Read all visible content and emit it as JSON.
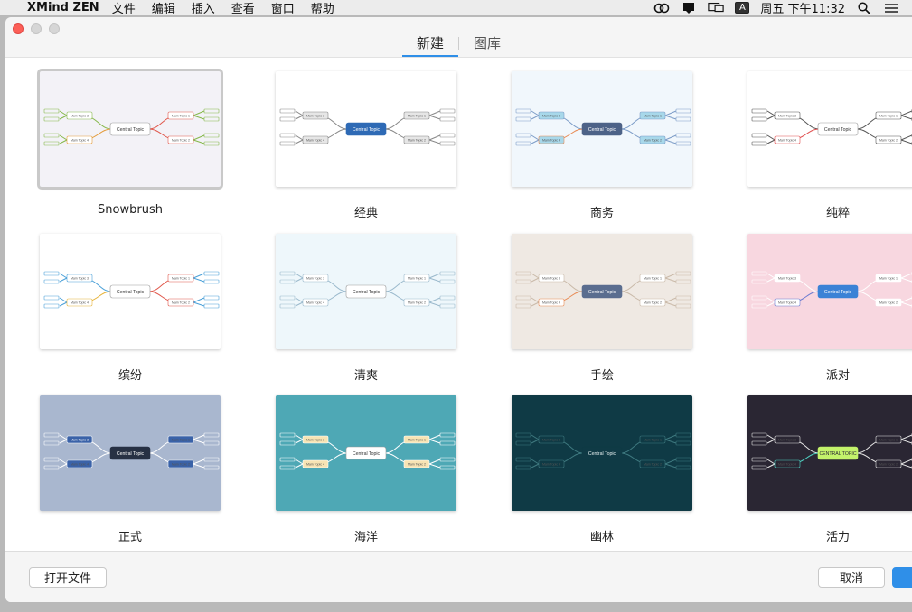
{
  "menubar": {
    "app_name": "XMind ZEN",
    "menus": [
      "文件",
      "编辑",
      "插入",
      "查看",
      "窗口",
      "帮助"
    ],
    "clock": "周五 下午11:32",
    "input_badge": "A"
  },
  "tabs": [
    {
      "label": "新建",
      "active": true
    },
    {
      "label": "图库",
      "active": false
    }
  ],
  "templates": [
    {
      "name": "Snowbrush",
      "bg": "#f3f2f7",
      "center": "#ffffff",
      "centerText": "#333333",
      "topic": "#ffffff",
      "line1": "#86b84a",
      "line2": "#e0584c",
      "line3": "#e39b3a",
      "central_label": "Central Topic",
      "main_labels": [
        "Main Topic 3",
        "Main Topic 1",
        "Main Topic 4",
        "Main Topic 2"
      ]
    },
    {
      "name": "经典",
      "bg": "#ffffff",
      "center": "#2e6ab5",
      "centerText": "#ffffff",
      "topic": "#e6e6e6",
      "line1": "#888888",
      "line2": "#888888",
      "line3": "#888888",
      "central_label": "Central Topic",
      "main_labels": [
        "Main Topic 3",
        "Main Topic 1",
        "Main Topic 4",
        "Main Topic 2"
      ]
    },
    {
      "name": "商务",
      "bg": "#f1f7fc",
      "center": "#4d6287",
      "centerText": "#ffffff",
      "topic": "#a8d8ea",
      "line1": "#7c9cc7",
      "line2": "#7c9cc7",
      "line3": "#e88b55",
      "central_label": "Central Topic",
      "main_labels": [
        "Main Topic 3",
        "Main Topic 1",
        "Main Topic 4",
        "Main Topic 2"
      ]
    },
    {
      "name": "纯粹",
      "bg": "#ffffff",
      "center": "#ffffff",
      "centerText": "#333333",
      "topic": "#ffffff",
      "line1": "#555555",
      "line2": "#555555",
      "line3": "#e05050",
      "central_label": "Central Topic",
      "main_labels": [
        "Main Topic 3",
        "Main Topic 1",
        "Main Topic 4",
        "Main Topic 2"
      ]
    },
    {
      "name": "缤纷",
      "bg": "#ffffff",
      "center": "#ffffff",
      "centerText": "#333333",
      "topic": "#ffffff",
      "line1": "#4aa0d8",
      "line2": "#e0584c",
      "line3": "#e6b33a",
      "central_label": "Central Topic",
      "main_labels": [
        "Main Topic 3",
        "Main Topic 1",
        "Main Topic 4",
        "Main Topic 2"
      ]
    },
    {
      "name": "清爽",
      "bg": "#eef7fb",
      "center": "#ffffff",
      "centerText": "#333333",
      "topic": "#ffffff",
      "line1": "#9ab9cc",
      "line2": "#9ab9cc",
      "line3": "#9ab9cc",
      "central_label": "Central Topic",
      "main_labels": [
        "Main Topic 3",
        "Main Topic 1",
        "Main Topic 4",
        "Main Topic 2"
      ]
    },
    {
      "name": "手绘",
      "bg": "#efe9e3",
      "center": "#5a6d8f",
      "centerText": "#ffffff",
      "topic": "#ffffff",
      "line1": "#c9b9a8",
      "line2": "#c9b9a8",
      "line3": "#e88b55",
      "central_label": "Central Topic",
      "main_labels": [
        "Main Topic 3",
        "Main Topic 1",
        "Main Topic 4",
        "Main Topic 2"
      ]
    },
    {
      "name": "派对",
      "bg": "#f8d7e0",
      "center": "#3b82d6",
      "centerText": "#ffffff",
      "topic": "#ffffff",
      "line1": "#ffffff",
      "line2": "#ffffff",
      "line3": "#6b7bd0",
      "central_label": "Central Topic",
      "main_labels": [
        "Main Topic 3",
        "Main Topic 1",
        "Main Topic 4",
        "Main Topic 2"
      ]
    },
    {
      "name": "正式",
      "bg": "#a9b7cf",
      "center": "#273144",
      "centerText": "#ffffff",
      "topic": "#3a62a8",
      "line1": "#ffffff",
      "line2": "#ffffff",
      "line3": "#ffffff",
      "central_label": "Central Topic",
      "main_labels": [
        "Main Topic 3",
        "Main Topic 1",
        "Main Topic 4",
        "Main Topic 2"
      ]
    },
    {
      "name": "海洋",
      "bg": "#4ea8b5",
      "center": "#ffffff",
      "centerText": "#333333",
      "topic": "#f7e4b4",
      "line1": "#ffffff",
      "line2": "#ffffff",
      "line3": "#ffffff",
      "central_label": "Central Topic",
      "main_labels": [
        "Main Topic 3",
        "Main Topic 1",
        "Main Topic 4",
        "Main Topic 2"
      ]
    },
    {
      "name": "幽林",
      "bg": "#0f3a45",
      "center": "#0f3a45",
      "centerText": "#e6f0f0",
      "topic": "#0f3a45",
      "line1": "#3f7a80",
      "line2": "#3f7a80",
      "line3": "#3f7a80",
      "central_label": "Central Topic",
      "main_labels": [
        "Main Topic 3",
        "Main Topic 1",
        "Main Topic 4",
        "Main Topic 2"
      ]
    },
    {
      "name": "活力",
      "bg": "#2a2633",
      "center": "#c3f26b",
      "centerText": "#2a2633",
      "topic": "#2a2633",
      "line1": "#e6e6e6",
      "line2": "#e6e6e6",
      "line3": "#4fd0c2",
      "central_label": "CENTRAL TOPIC",
      "main_labels": [
        "Main Topic 3",
        "Main Topic 1",
        "Main Topic 4",
        "Main Topic 2"
      ]
    }
  ],
  "footer": {
    "open_file": "打开文件",
    "cancel": "取消",
    "create": ""
  }
}
